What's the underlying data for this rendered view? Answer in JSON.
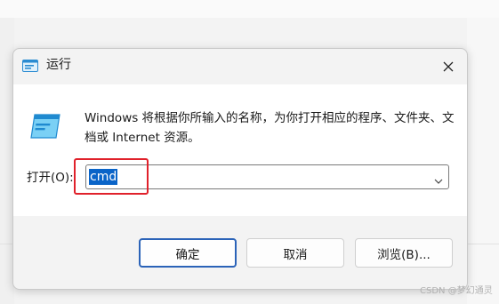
{
  "window": {
    "title": "运行",
    "title_icon": "run-dialog-icon",
    "close_icon": "close-icon"
  },
  "content": {
    "description": "Windows 将根据你所输入的名称，为你打开相应的程序、文件夹、文档或 Internet 资源。",
    "open_label": "打开(O):",
    "command_value": "cmd",
    "dropdown_icon": "chevron-down-icon"
  },
  "buttons": {
    "ok": "确定",
    "cancel": "取消",
    "browse": "浏览(B)..."
  },
  "watermark": "CSDN @梦幻通灵",
  "colors": {
    "accent": "#0a64c8",
    "highlight_box": "#e0212b",
    "ok_border": "#2b63b8"
  }
}
